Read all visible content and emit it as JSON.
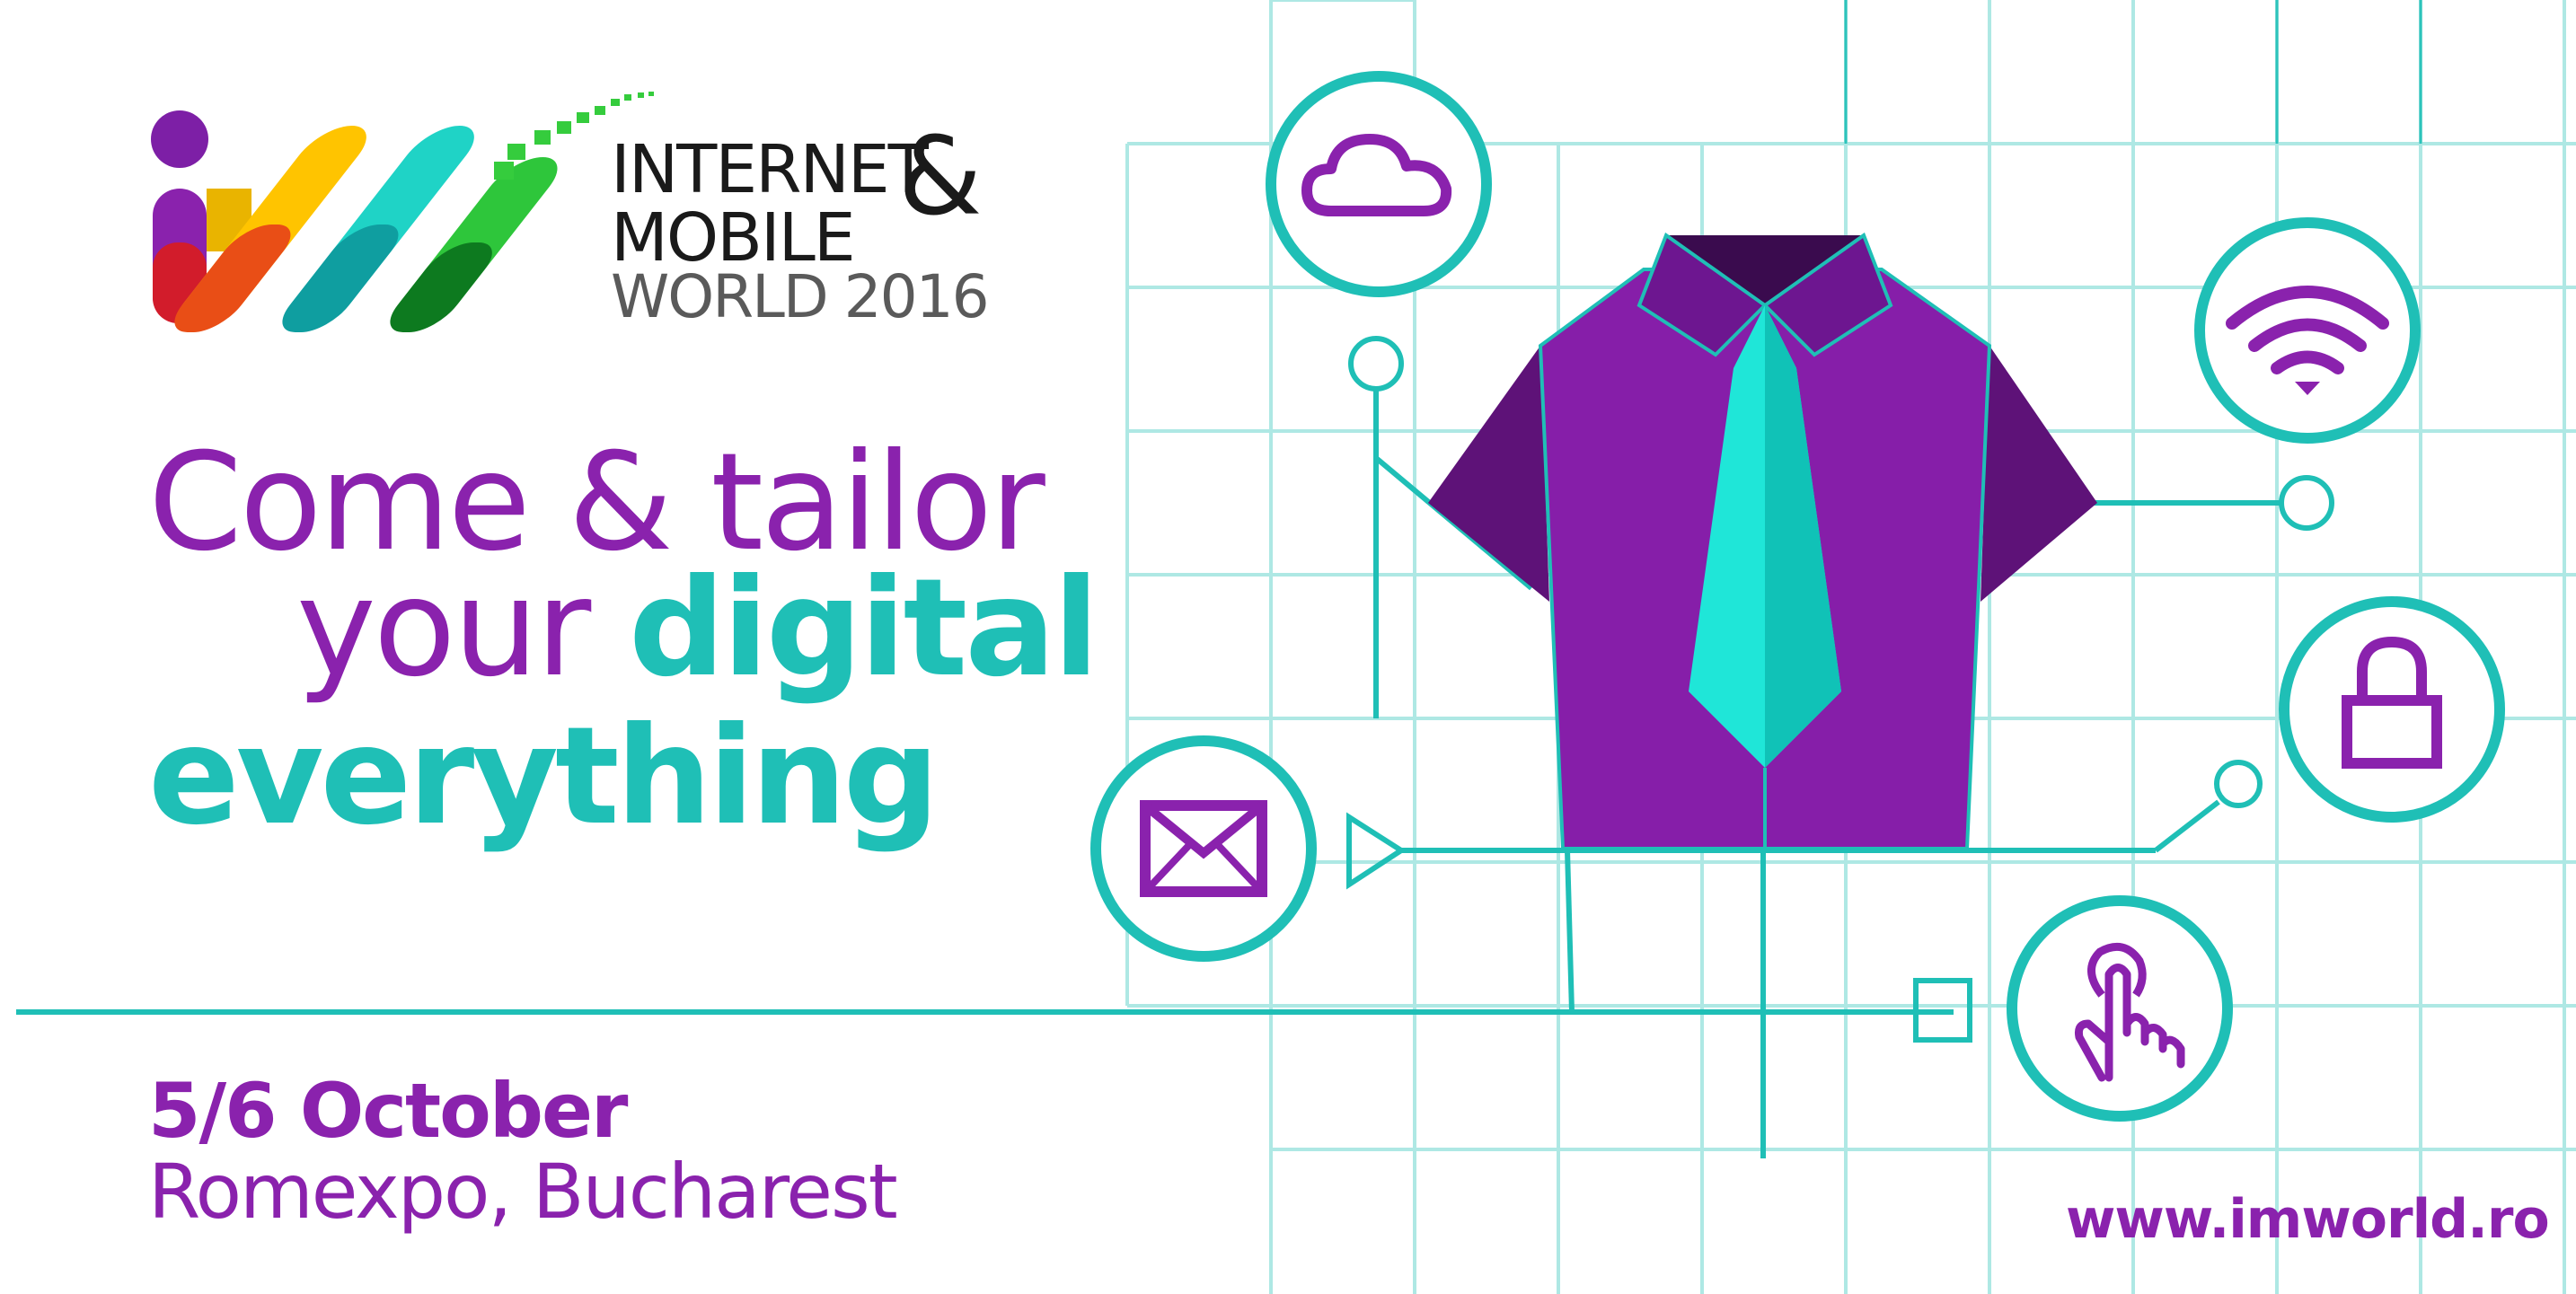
{
  "logo": {
    "line1": "INTERNET",
    "ampersand": "&",
    "line2": "MOBILE",
    "line3": "WORLD 2016"
  },
  "headline": {
    "line1": "Come & tailor",
    "line2_plain": "your",
    "line2_bold": "digital",
    "line3": "everything"
  },
  "event": {
    "date": "5/6 October",
    "venue": "Romexpo, Bucharest"
  },
  "website": "www.imworld.ro",
  "colors": {
    "purple": "#8a22ad",
    "dark_purple": "#5e1278",
    "teal": "#1fbfb6",
    "light_teal": "#1fe6d8",
    "grid": "#aee8e4",
    "logo_gray": "#555555"
  },
  "icons": [
    "cloud-icon",
    "wifi-icon",
    "lock-icon",
    "mail-icon",
    "touch-hand-icon",
    "shirt-with-tie-illustration"
  ]
}
